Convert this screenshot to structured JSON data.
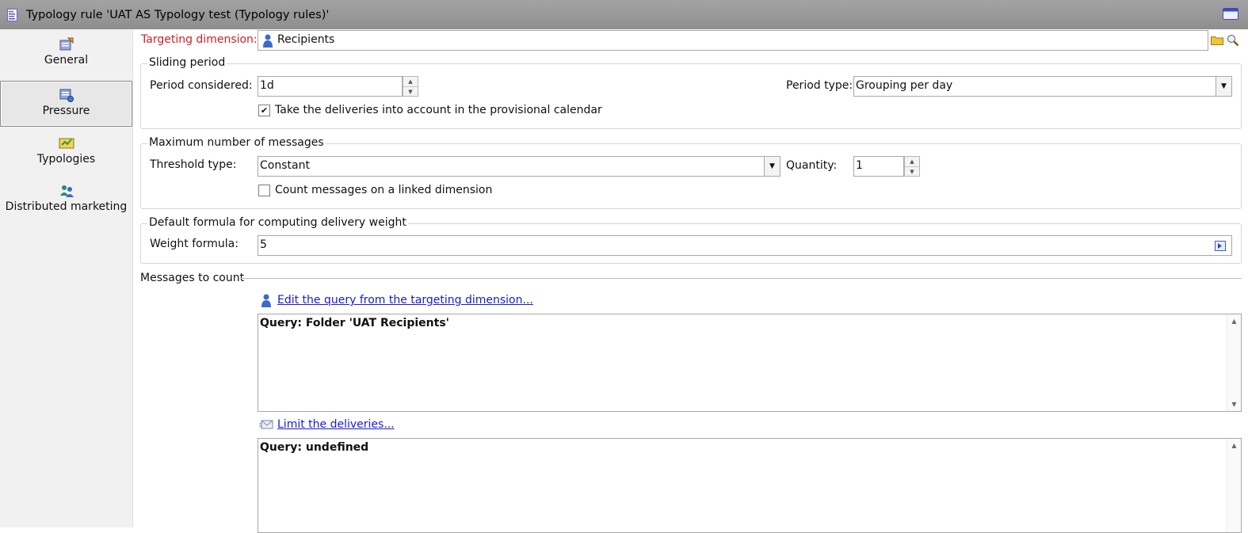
{
  "window": {
    "title": "Typology rule 'UAT AS Typology test (Typology rules)'"
  },
  "sidebar": {
    "items": [
      {
        "label": "General"
      },
      {
        "label": "Pressure"
      },
      {
        "label": "Typologies"
      },
      {
        "label": "Distributed marketing"
      }
    ],
    "active_index": 1
  },
  "targeting": {
    "label": "Targeting dimension:",
    "value": "Recipients"
  },
  "sliding_period": {
    "title": "Sliding period",
    "period_considered_label": "Period considered:",
    "period_considered_value": "1d",
    "period_type_label": "Period type:",
    "period_type_value": "Grouping per day",
    "provisional_label": "Take the deliveries into account in the provisional calendar",
    "provisional_checked": true
  },
  "max_messages": {
    "title": "Maximum number of messages",
    "threshold_label": "Threshold type:",
    "threshold_value": "Constant",
    "quantity_label": "Quantity:",
    "quantity_value": "1",
    "linked_label": "Count messages on a linked dimension",
    "linked_checked": false
  },
  "weight": {
    "title": "Default formula for computing delivery weight",
    "formula_label": "Weight formula:",
    "formula_value": "5"
  },
  "messages": {
    "title": "Messages to count",
    "edit_query_link": "Edit the query from the targeting dimension...",
    "query1": "Query: Folder 'UAT Recipients'",
    "limit_link": "Limit the deliveries...",
    "query2": "Query: undefined"
  },
  "colors": {
    "accent_red": "#d21f1f",
    "link": "#1a1ad6",
    "titlebar": "#979797"
  }
}
